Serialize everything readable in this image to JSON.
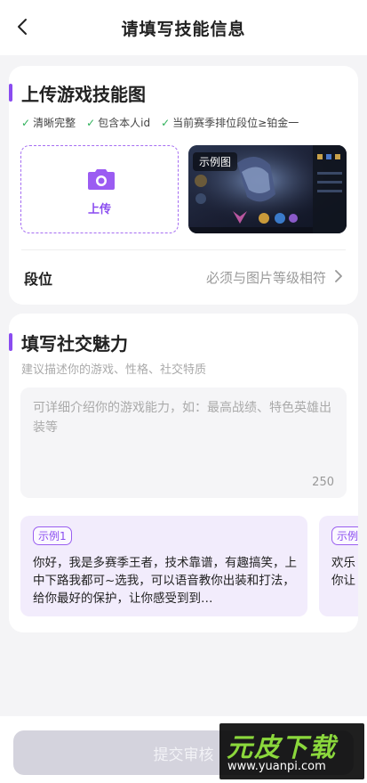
{
  "nav": {
    "title": "请填写技能信息",
    "back_icon": "chevron-left-icon"
  },
  "skill_image": {
    "title": "上传游戏技能图",
    "checks": [
      "清晰完整",
      "包含本人id",
      "当前赛季排位段位≥铂金一"
    ],
    "upload_label": "上传",
    "example_tag": "示例图"
  },
  "rank": {
    "label": "段位",
    "placeholder": "必须与图片等级相符"
  },
  "social": {
    "title": "填写社交魅力",
    "hint": "建议描述你的游戏、性格、社交特质",
    "placeholder": "可详细介绍你的游戏能力，如：最高战绩、特色英雄出装等",
    "char_count": "250",
    "examples": [
      {
        "badge": "示例1",
        "text": "你好，我是多赛季王者，技术靠谱，有趣搞笑，上中下路我都可~选我，可以语音教你出装和打法，给你最好的保护，让你感受到到…"
      },
      {
        "badge": "示例",
        "text": "欢乐你让"
      }
    ]
  },
  "submit_label": "提交审核",
  "watermark": {
    "main": "元皮下载",
    "url": "www.yuanpi.com"
  },
  "colors": {
    "accent": "#8a4cf0",
    "check": "#2eb15a",
    "submit_disabled": "#d4d3dd"
  }
}
